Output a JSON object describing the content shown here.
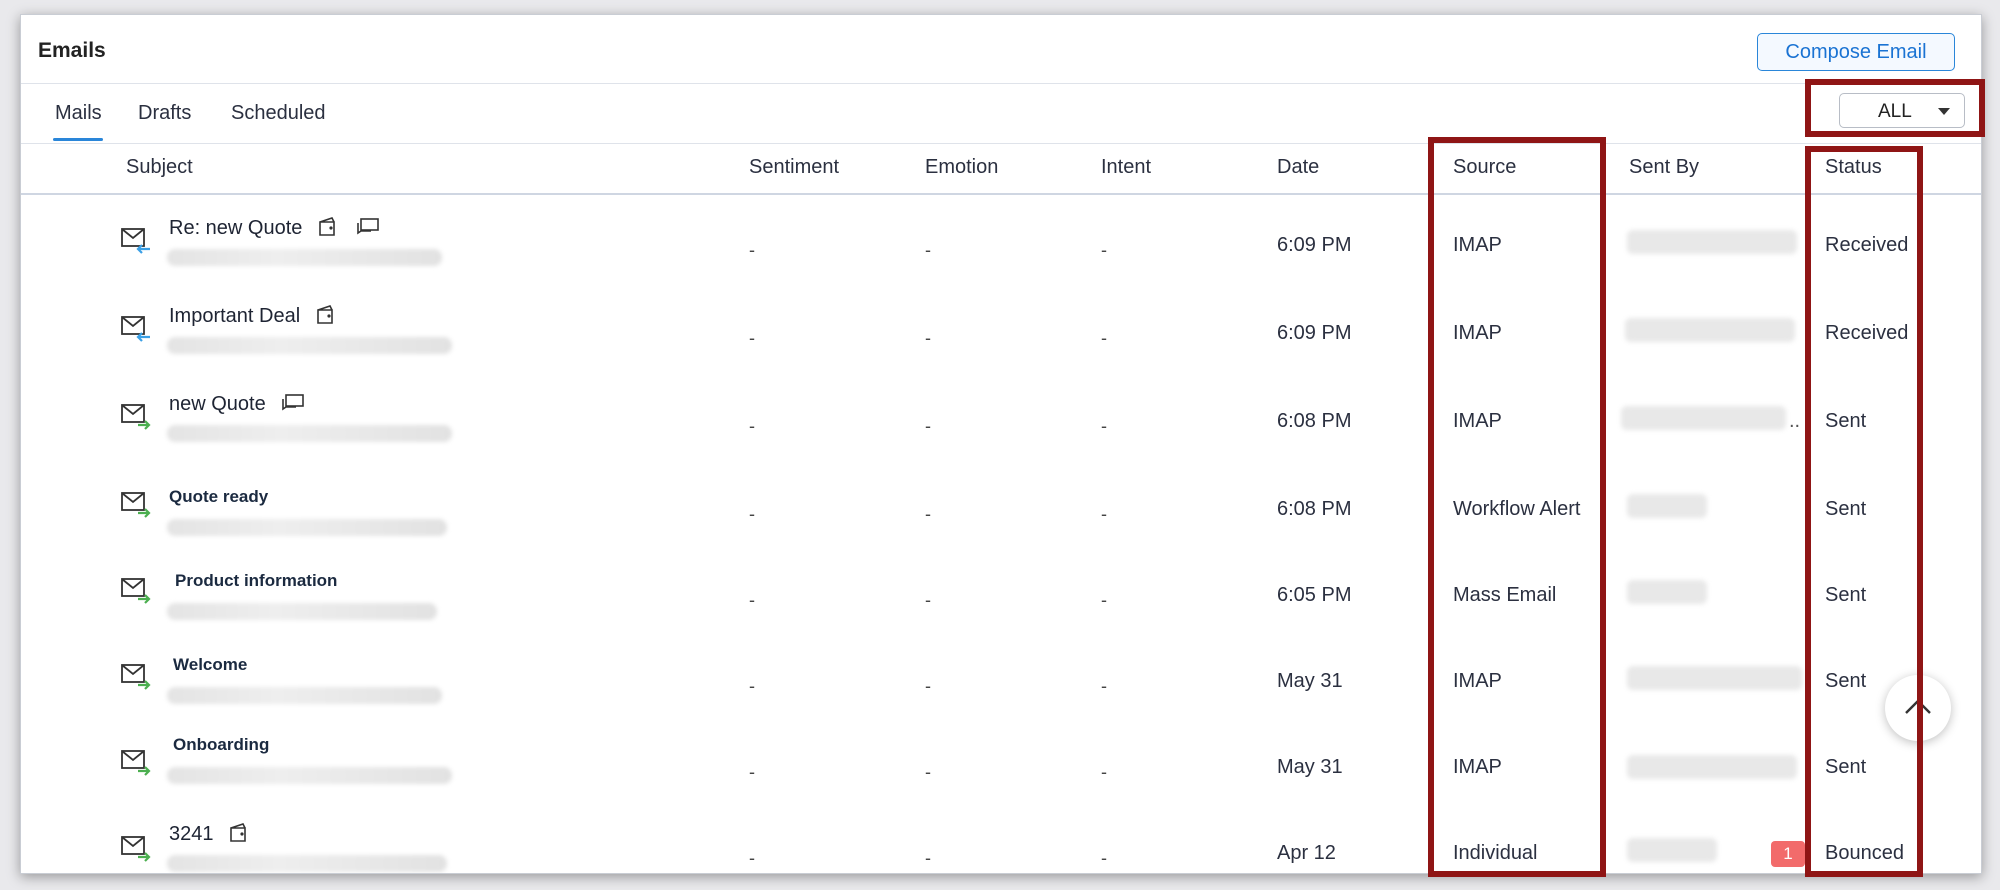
{
  "header": {
    "title": "Emails",
    "compose_label": "Compose Email"
  },
  "tabs": [
    {
      "label": "Mails",
      "active": true
    },
    {
      "label": "Drafts",
      "active": false
    },
    {
      "label": "Scheduled",
      "active": false
    }
  ],
  "filter": {
    "value": "ALL",
    "icon": "caret-down-icon"
  },
  "columns": [
    "Subject",
    "Sentiment",
    "Emotion",
    "Intent",
    "Date",
    "Source",
    "Sent By",
    "Status"
  ],
  "rows": [
    {
      "subject": "Re: new Quote",
      "sentiment": "-",
      "emotion": "-",
      "intent": "-",
      "date": "6:09 PM",
      "source": "IMAP",
      "sent_by": "",
      "status": "Received"
    },
    {
      "subject": "Important Deal",
      "sentiment": "-",
      "emotion": "-",
      "intent": "-",
      "date": "6:09 PM",
      "source": "IMAP",
      "sent_by": "",
      "status": "Received"
    },
    {
      "subject": "new Quote",
      "sentiment": "-",
      "emotion": "-",
      "intent": "-",
      "date": "6:08 PM",
      "source": "IMAP",
      "sent_by": "..",
      "status": "Sent"
    },
    {
      "subject": "Quote ready",
      "sentiment": "-",
      "emotion": "-",
      "intent": "-",
      "date": "6:08 PM",
      "source": "Workflow Alert",
      "sent_by": "",
      "status": "Sent"
    },
    {
      "subject": "Product information",
      "sentiment": "-",
      "emotion": "-",
      "intent": "-",
      "date": "6:05 PM",
      "source": "Mass Email",
      "sent_by": "",
      "status": "Sent"
    },
    {
      "subject": "Welcome",
      "sentiment": "-",
      "emotion": "-",
      "intent": "-",
      "date": "May 31",
      "source": "IMAP",
      "sent_by": "",
      "status": "Sent"
    },
    {
      "subject": "Onboarding",
      "sentiment": "-",
      "emotion": "-",
      "intent": "-",
      "date": "May 31",
      "source": "IMAP",
      "sent_by": "",
      "status": "Sent"
    },
    {
      "subject": "3241",
      "sentiment": "-",
      "emotion": "-",
      "intent": "-",
      "date": "Apr 12",
      "source": "Individual",
      "sent_by": "",
      "status": "Bounced",
      "badge": "1"
    }
  ],
  "colors": {
    "accent": "#2a86d9",
    "highlight": "#8f1515",
    "incoming_arrow": "#3ba0e6",
    "outgoing_arrow": "#4caf50",
    "badge": "#f26b6b"
  }
}
